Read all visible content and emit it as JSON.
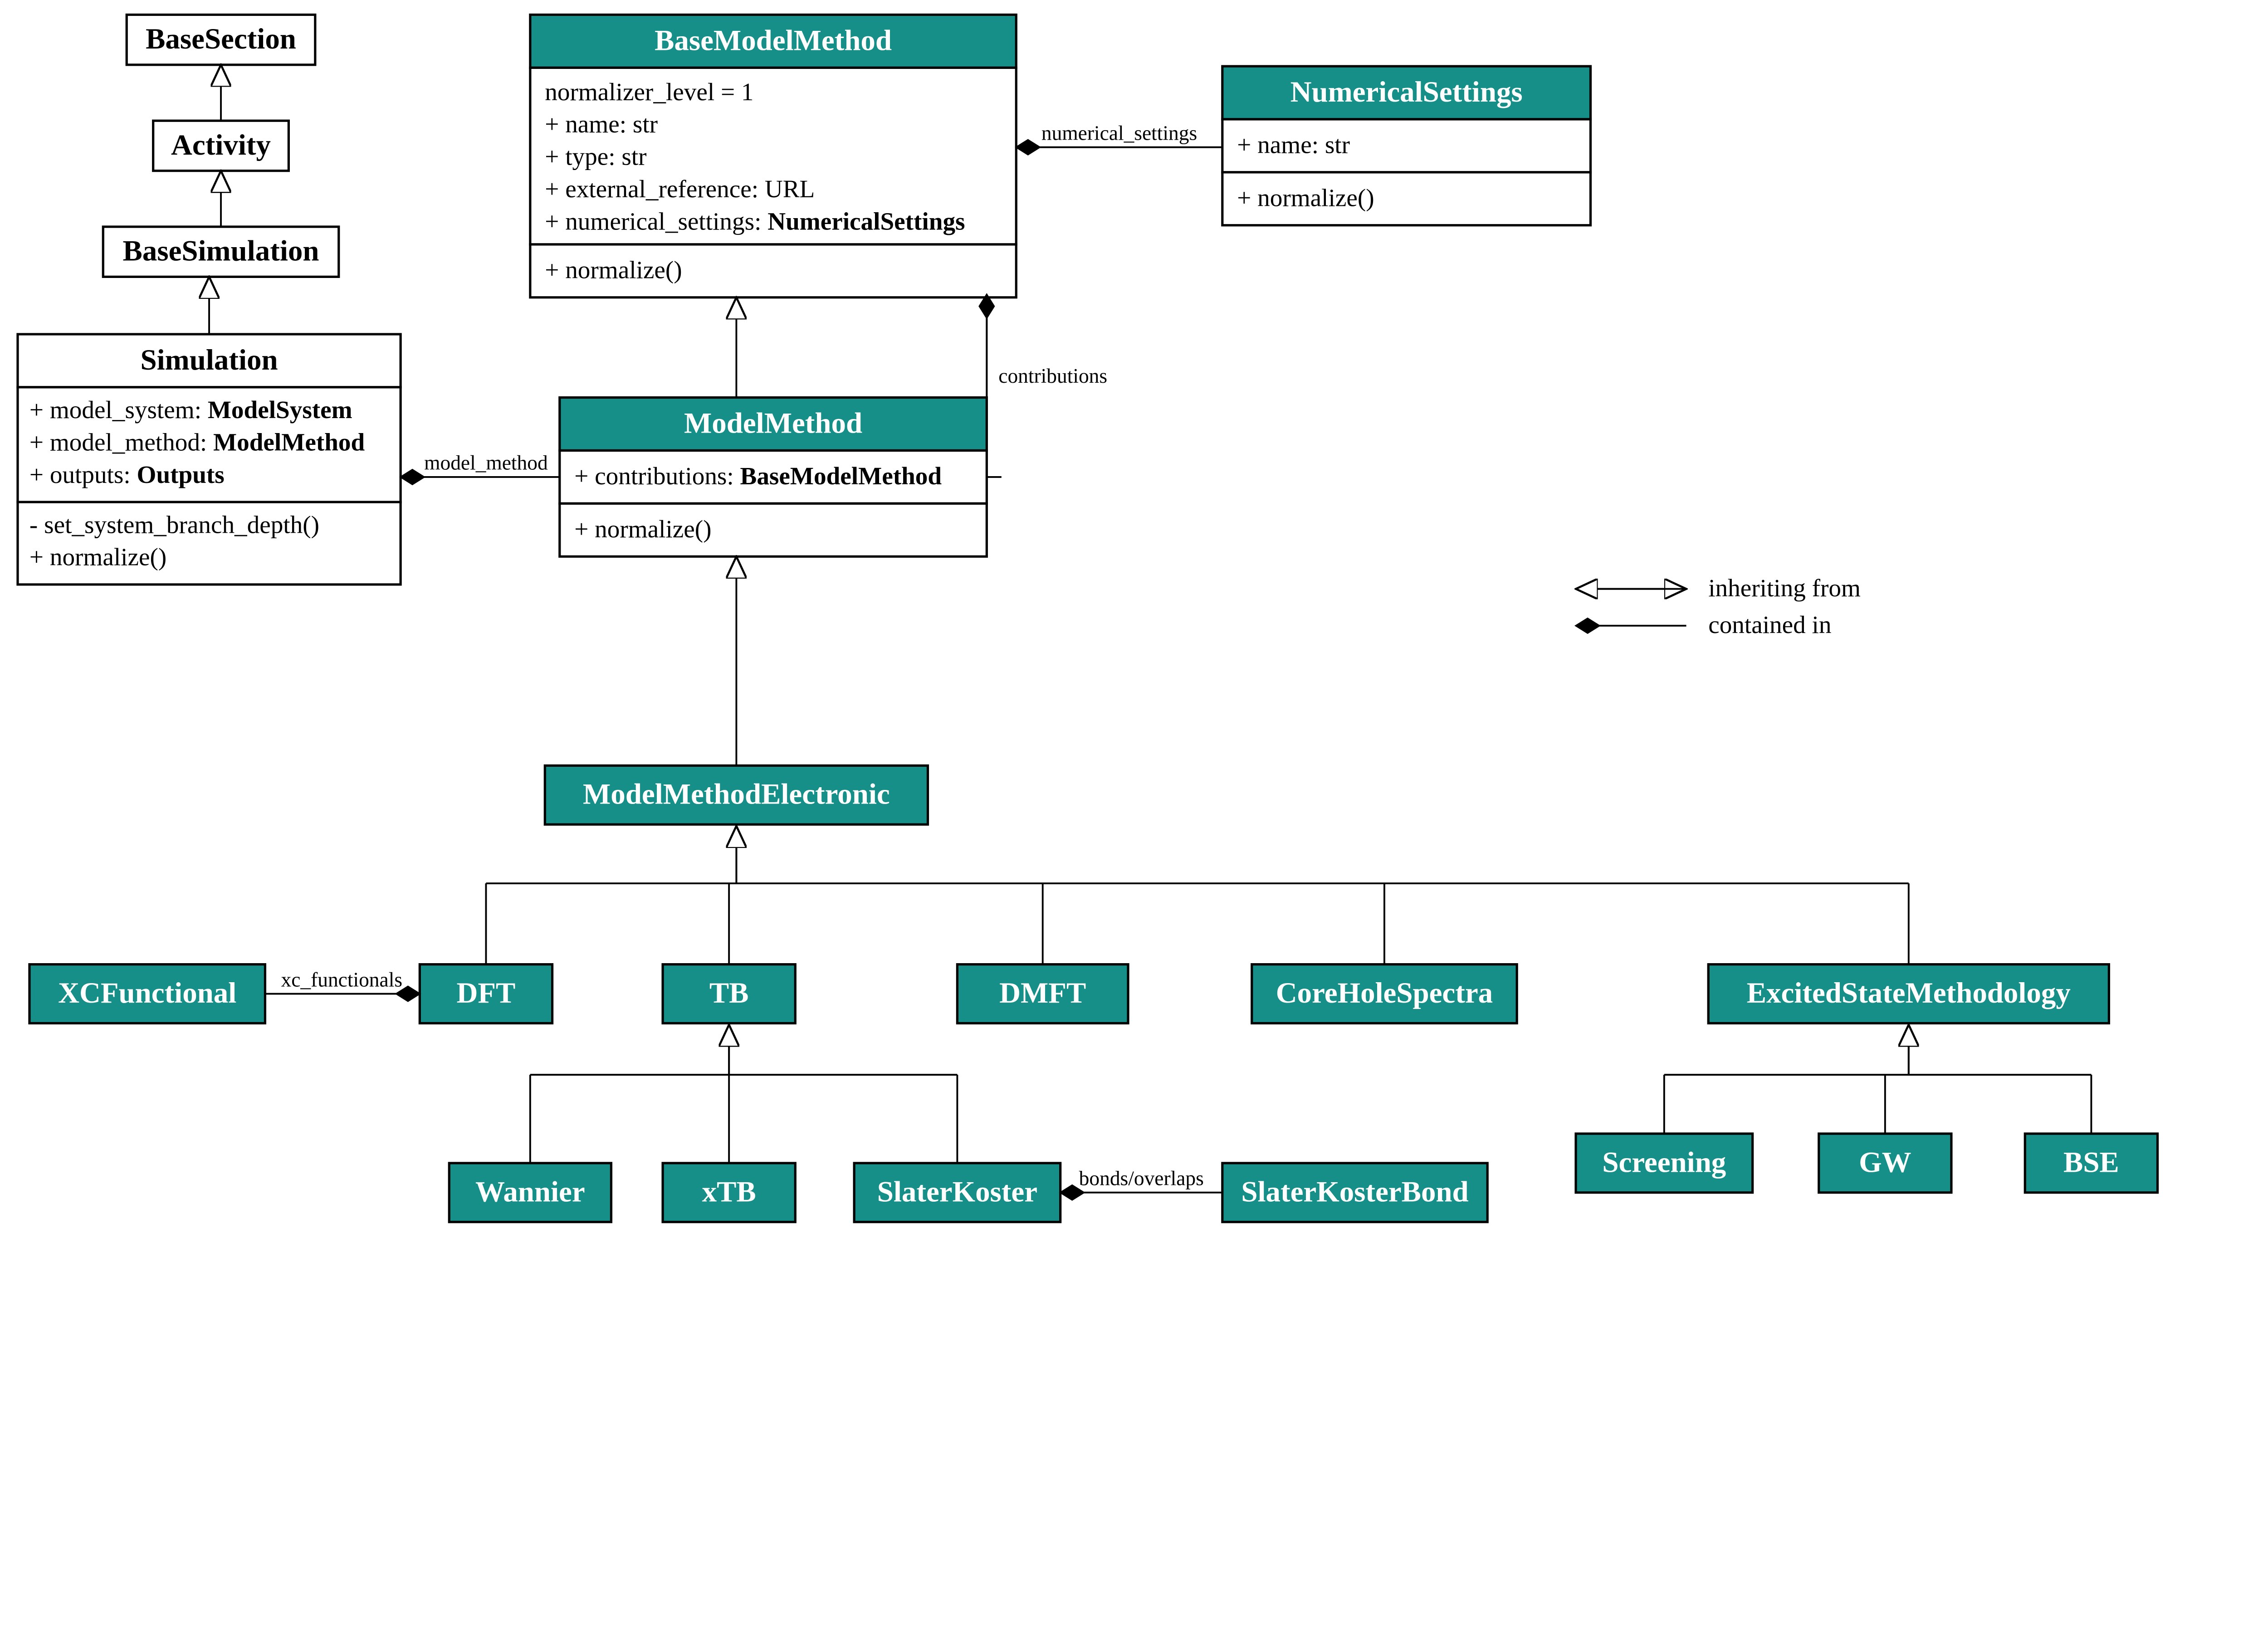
{
  "classes": {
    "BaseSection": {
      "title": "BaseSection"
    },
    "Activity": {
      "title": "Activity"
    },
    "BaseSimulation": {
      "title": "BaseSimulation"
    },
    "Simulation": {
      "title": "Simulation",
      "attrs": [
        {
          "pre": "+ model_system: ",
          "b": "ModelSystem"
        },
        {
          "pre": "+ model_method: ",
          "b": "ModelMethod"
        },
        {
          "pre": "+ outputs: ",
          "b": "Outputs"
        }
      ],
      "ops": [
        "- set_system_branch_depth()",
        "+ normalize()"
      ]
    },
    "BaseModelMethod": {
      "title": "BaseModelMethod",
      "attrs": [
        {
          "pre": "normalizer_level = 1"
        },
        {
          "pre": "+ name: str"
        },
        {
          "pre": "+ type: str"
        },
        {
          "pre": "+ external_reference: URL"
        },
        {
          "pre": "+ numerical_settings: ",
          "b": "NumericalSettings"
        }
      ],
      "ops": [
        "+ normalize()"
      ]
    },
    "NumericalSettings": {
      "title": "NumericalSettings",
      "attrs": [
        {
          "pre": "+ name: str"
        }
      ],
      "ops": [
        "+ normalize()"
      ]
    },
    "ModelMethod": {
      "title": "ModelMethod",
      "attrs": [
        {
          "pre": "+ contributions: ",
          "b": "BaseModelMethod"
        }
      ],
      "ops": [
        "+ normalize()"
      ]
    },
    "ModelMethodElectronic": {
      "title": "ModelMethodElectronic"
    },
    "XCFunctional": {
      "title": "XCFunctional"
    },
    "DFT": {
      "title": "DFT"
    },
    "TB": {
      "title": "TB"
    },
    "DMFT": {
      "title": "DMFT"
    },
    "CoreHoleSpectra": {
      "title": "CoreHoleSpectra"
    },
    "ExcitedStateMethodology": {
      "title": "ExcitedStateMethodology"
    },
    "Wannier": {
      "title": "Wannier"
    },
    "xTB": {
      "title": "xTB"
    },
    "SlaterKoster": {
      "title": "SlaterKoster"
    },
    "SlaterKosterBond": {
      "title": "SlaterKosterBond"
    },
    "Screening": {
      "title": "Screening"
    },
    "GW": {
      "title": "GW"
    },
    "BSE": {
      "title": "BSE"
    }
  },
  "edges": {
    "model_method": "model_method",
    "numerical_settings": "numerical_settings",
    "contributions": "contributions",
    "xc_functionals": "xc_functionals",
    "bonds_overlaps": "bonds/overlaps"
  },
  "legend": {
    "inheriting": "inheriting from",
    "contained": "contained in"
  }
}
